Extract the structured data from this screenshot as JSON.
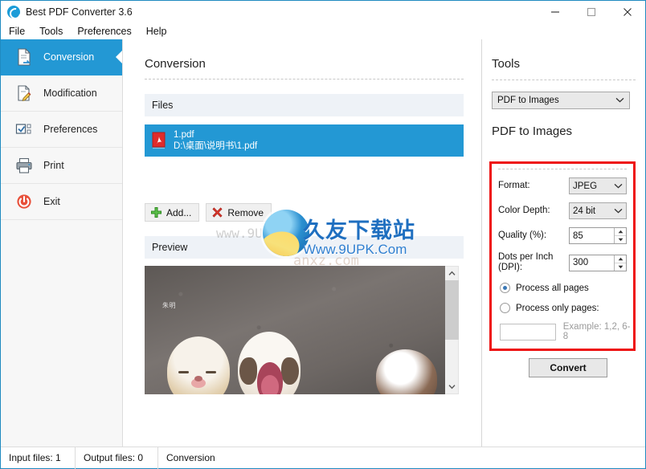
{
  "window": {
    "title": "Best PDF Converter 3.6",
    "icon": "app-refresh-icon",
    "controls": {
      "minimize": "minimize-icon",
      "maximize": "maximize-icon",
      "close": "close-icon"
    }
  },
  "menubar": {
    "items": [
      "File",
      "Tools",
      "Preferences",
      "Help"
    ]
  },
  "sidebar": {
    "items": [
      {
        "label": "Conversion",
        "icon": "document-convert-icon",
        "active": true
      },
      {
        "label": "Modification",
        "icon": "document-edit-icon",
        "active": false
      },
      {
        "label": "Preferences",
        "icon": "checkbox-settings-icon",
        "active": false
      },
      {
        "label": "Print",
        "icon": "printer-icon",
        "active": false
      },
      {
        "label": "Exit",
        "icon": "power-icon",
        "active": false
      }
    ],
    "active_accent": "#2398d4"
  },
  "center": {
    "title": "Conversion",
    "files_section": {
      "header": "Files"
    },
    "files": [
      {
        "name": "1.pdf",
        "path": "D:\\桌面\\说明书\\1.pdf",
        "icon": "pdf-file-icon",
        "selected": true
      }
    ],
    "file_buttons": [
      {
        "label": "Add...",
        "icon": "plus-icon"
      },
      {
        "label": "Remove",
        "icon": "cross-icon"
      }
    ],
    "preview_section": {
      "header": "Preview"
    },
    "preview": {
      "alt": "photo of three puppies on a gray textured background",
      "signature": "朱明"
    }
  },
  "tools": {
    "title": "Tools",
    "tool_select": {
      "value": "PDF to Images",
      "chevron": "chevron-down-icon"
    },
    "subtitle": "PDF to Images",
    "highlight_color": "#ee1111",
    "fields": [
      {
        "label": "Format:",
        "type": "select",
        "value": "JPEG"
      },
      {
        "label": "Color Depth:",
        "type": "select",
        "value": "24 bit"
      },
      {
        "label": "Quality (%):",
        "type": "spinner",
        "value": "85"
      },
      {
        "label": "Dots per Inch (DPI):",
        "type": "spinner",
        "value": "300"
      }
    ],
    "radios": [
      {
        "label": "Process all pages",
        "checked": true
      },
      {
        "label": "Process only pages:",
        "checked": false
      }
    ],
    "pages_input": {
      "value": "",
      "hint": "Example: 1,2, 6-8"
    },
    "convert_button": "Convert"
  },
  "statusbar": {
    "input_files": "Input files: 1",
    "output_files": "Output files: 0",
    "mode": "Conversion"
  },
  "watermark": {
    "faint_top": "www.9UPK.COM",
    "faint_bottom": "anxz.com",
    "chinese": "久友下载站",
    "english": "Www.9UPK.Com"
  }
}
